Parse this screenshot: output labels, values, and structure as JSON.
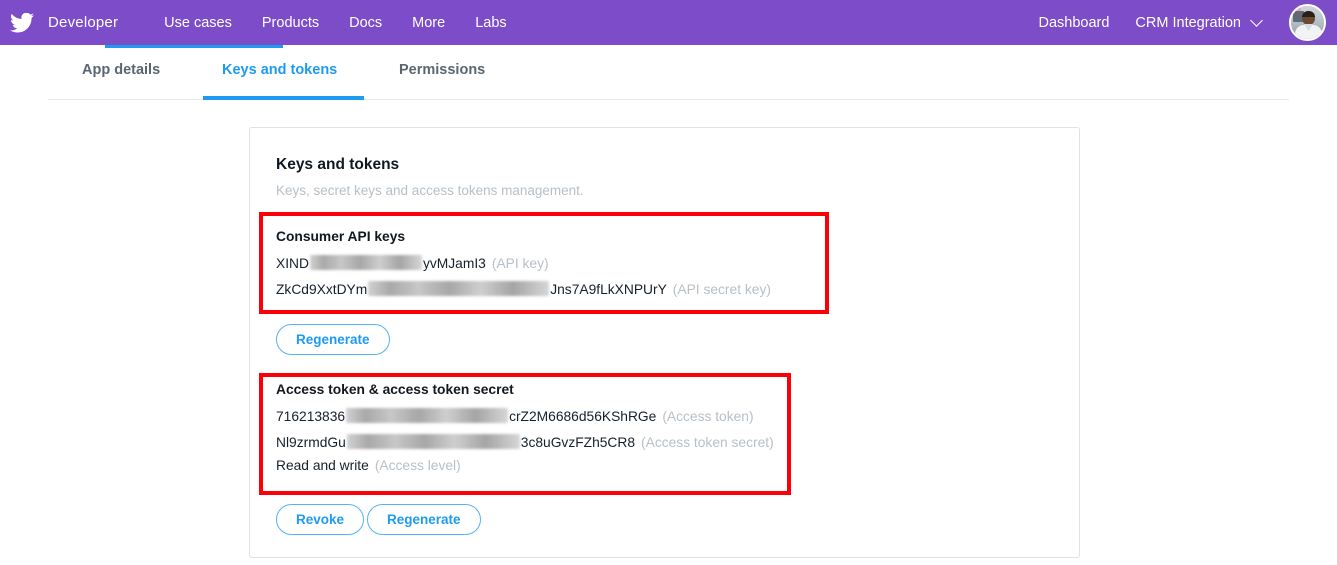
{
  "topnav": {
    "logo_icon": "twitter-bird-icon",
    "brand": "Developer",
    "links": [
      {
        "label": "Use cases"
      },
      {
        "label": "Products"
      },
      {
        "label": "Docs"
      },
      {
        "label": "More"
      },
      {
        "label": "Labs"
      }
    ],
    "right": {
      "dashboard": "Dashboard",
      "account": "CRM Integration",
      "chevron_icon": "chevron-down-icon",
      "avatar_icon": "user-avatar-photo"
    },
    "background_color": "#7D4CC8"
  },
  "tabs": {
    "items": [
      {
        "label": "App details",
        "active": false
      },
      {
        "label": "Keys and tokens",
        "active": true
      },
      {
        "label": "Permissions",
        "active": false
      }
    ],
    "accent_color": "#1D9BF0"
  },
  "card": {
    "title": "Keys and tokens",
    "subtitle": "Keys, secret keys and access tokens management."
  },
  "consumer_section": {
    "title": "Consumer API keys",
    "rows": [
      {
        "prefix": "XIND",
        "redacted": true,
        "suffix": "yvMJamI3",
        "label": "(API key)"
      },
      {
        "prefix": "ZkCd9XxtDYm",
        "redacted": true,
        "suffix": "Jns7A9fLkXNPUrY",
        "label": "(API secret key)"
      }
    ],
    "regenerate_label": "Regenerate"
  },
  "access_section": {
    "title": "Access token & access token secret",
    "rows": [
      {
        "prefix": "716213836",
        "redacted": true,
        "suffix": "crZ2M6686d56KShRGe",
        "label": "(Access token)"
      },
      {
        "prefix": "Nl9zrmdGu",
        "redacted": true,
        "suffix": "3c8uGvzFZh5CR8",
        "label": "(Access token secret)"
      },
      {
        "prefix": "Read and write",
        "redacted": false,
        "suffix": "",
        "label": "(Access level)"
      }
    ],
    "revoke_label": "Revoke",
    "regenerate_label": "Regenerate"
  },
  "annotations": {
    "box_color": "#fb0007",
    "boxes": [
      {
        "target": "Consumer API keys"
      },
      {
        "target": "Access token & access token secret"
      }
    ]
  }
}
